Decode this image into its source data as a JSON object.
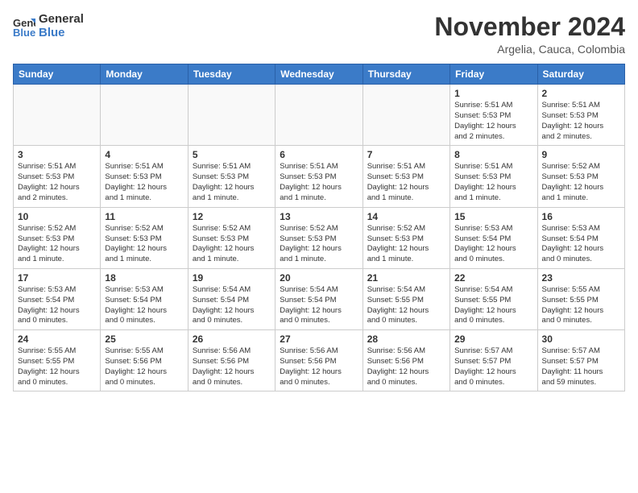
{
  "header": {
    "logo_line1": "General",
    "logo_line2": "Blue",
    "month": "November 2024",
    "location": "Argelia, Cauca, Colombia"
  },
  "weekdays": [
    "Sunday",
    "Monday",
    "Tuesday",
    "Wednesday",
    "Thursday",
    "Friday",
    "Saturday"
  ],
  "weeks": [
    [
      {
        "day": "",
        "info": ""
      },
      {
        "day": "",
        "info": ""
      },
      {
        "day": "",
        "info": ""
      },
      {
        "day": "",
        "info": ""
      },
      {
        "day": "",
        "info": ""
      },
      {
        "day": "1",
        "info": "Sunrise: 5:51 AM\nSunset: 5:53 PM\nDaylight: 12 hours\nand 2 minutes."
      },
      {
        "day": "2",
        "info": "Sunrise: 5:51 AM\nSunset: 5:53 PM\nDaylight: 12 hours\nand 2 minutes."
      }
    ],
    [
      {
        "day": "3",
        "info": "Sunrise: 5:51 AM\nSunset: 5:53 PM\nDaylight: 12 hours\nand 2 minutes."
      },
      {
        "day": "4",
        "info": "Sunrise: 5:51 AM\nSunset: 5:53 PM\nDaylight: 12 hours\nand 1 minute."
      },
      {
        "day": "5",
        "info": "Sunrise: 5:51 AM\nSunset: 5:53 PM\nDaylight: 12 hours\nand 1 minute."
      },
      {
        "day": "6",
        "info": "Sunrise: 5:51 AM\nSunset: 5:53 PM\nDaylight: 12 hours\nand 1 minute."
      },
      {
        "day": "7",
        "info": "Sunrise: 5:51 AM\nSunset: 5:53 PM\nDaylight: 12 hours\nand 1 minute."
      },
      {
        "day": "8",
        "info": "Sunrise: 5:51 AM\nSunset: 5:53 PM\nDaylight: 12 hours\nand 1 minute."
      },
      {
        "day": "9",
        "info": "Sunrise: 5:52 AM\nSunset: 5:53 PM\nDaylight: 12 hours\nand 1 minute."
      }
    ],
    [
      {
        "day": "10",
        "info": "Sunrise: 5:52 AM\nSunset: 5:53 PM\nDaylight: 12 hours\nand 1 minute."
      },
      {
        "day": "11",
        "info": "Sunrise: 5:52 AM\nSunset: 5:53 PM\nDaylight: 12 hours\nand 1 minute."
      },
      {
        "day": "12",
        "info": "Sunrise: 5:52 AM\nSunset: 5:53 PM\nDaylight: 12 hours\nand 1 minute."
      },
      {
        "day": "13",
        "info": "Sunrise: 5:52 AM\nSunset: 5:53 PM\nDaylight: 12 hours\nand 1 minute."
      },
      {
        "day": "14",
        "info": "Sunrise: 5:52 AM\nSunset: 5:53 PM\nDaylight: 12 hours\nand 1 minute."
      },
      {
        "day": "15",
        "info": "Sunrise: 5:53 AM\nSunset: 5:54 PM\nDaylight: 12 hours\nand 0 minutes."
      },
      {
        "day": "16",
        "info": "Sunrise: 5:53 AM\nSunset: 5:54 PM\nDaylight: 12 hours\nand 0 minutes."
      }
    ],
    [
      {
        "day": "17",
        "info": "Sunrise: 5:53 AM\nSunset: 5:54 PM\nDaylight: 12 hours\nand 0 minutes."
      },
      {
        "day": "18",
        "info": "Sunrise: 5:53 AM\nSunset: 5:54 PM\nDaylight: 12 hours\nand 0 minutes."
      },
      {
        "day": "19",
        "info": "Sunrise: 5:54 AM\nSunset: 5:54 PM\nDaylight: 12 hours\nand 0 minutes."
      },
      {
        "day": "20",
        "info": "Sunrise: 5:54 AM\nSunset: 5:54 PM\nDaylight: 12 hours\nand 0 minutes."
      },
      {
        "day": "21",
        "info": "Sunrise: 5:54 AM\nSunset: 5:55 PM\nDaylight: 12 hours\nand 0 minutes."
      },
      {
        "day": "22",
        "info": "Sunrise: 5:54 AM\nSunset: 5:55 PM\nDaylight: 12 hours\nand 0 minutes."
      },
      {
        "day": "23",
        "info": "Sunrise: 5:55 AM\nSunset: 5:55 PM\nDaylight: 12 hours\nand 0 minutes."
      }
    ],
    [
      {
        "day": "24",
        "info": "Sunrise: 5:55 AM\nSunset: 5:55 PM\nDaylight: 12 hours\nand 0 minutes."
      },
      {
        "day": "25",
        "info": "Sunrise: 5:55 AM\nSunset: 5:56 PM\nDaylight: 12 hours\nand 0 minutes."
      },
      {
        "day": "26",
        "info": "Sunrise: 5:56 AM\nSunset: 5:56 PM\nDaylight: 12 hours\nand 0 minutes."
      },
      {
        "day": "27",
        "info": "Sunrise: 5:56 AM\nSunset: 5:56 PM\nDaylight: 12 hours\nand 0 minutes."
      },
      {
        "day": "28",
        "info": "Sunrise: 5:56 AM\nSunset: 5:56 PM\nDaylight: 12 hours\nand 0 minutes."
      },
      {
        "day": "29",
        "info": "Sunrise: 5:57 AM\nSunset: 5:57 PM\nDaylight: 12 hours\nand 0 minutes."
      },
      {
        "day": "30",
        "info": "Sunrise: 5:57 AM\nSunset: 5:57 PM\nDaylight: 11 hours\nand 59 minutes."
      }
    ]
  ]
}
